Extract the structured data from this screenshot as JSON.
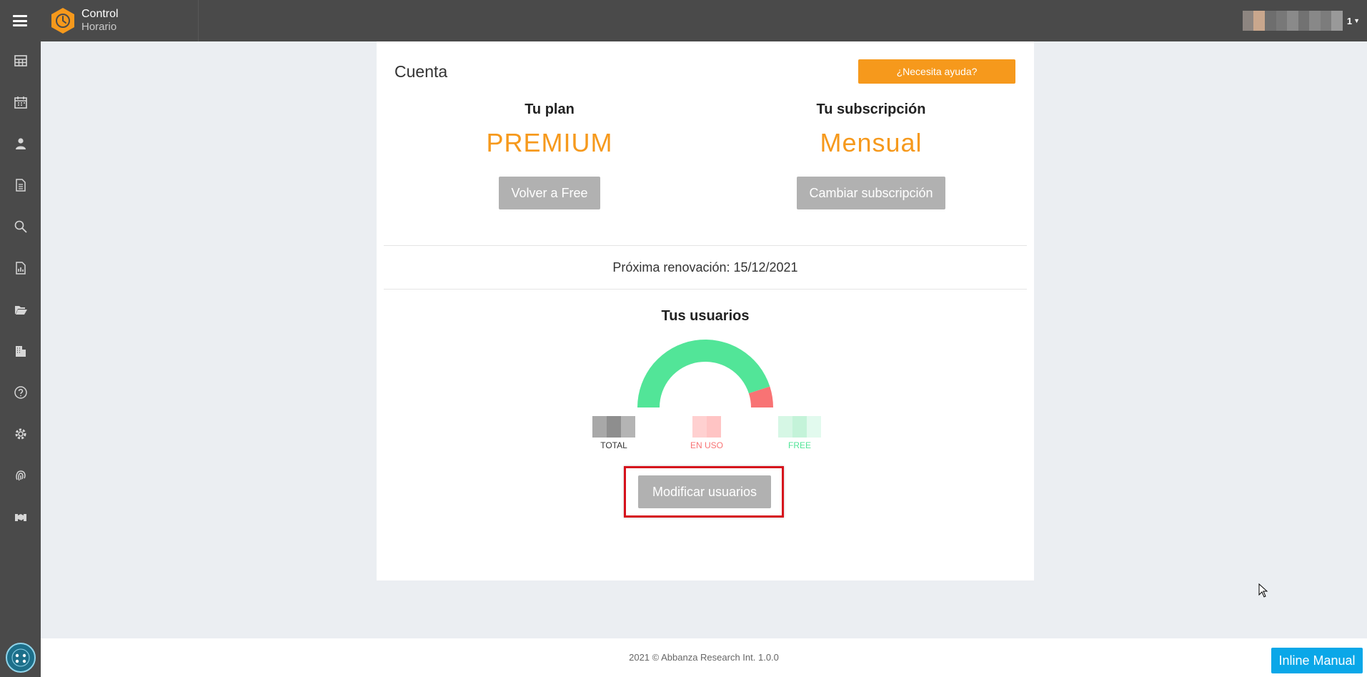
{
  "app": {
    "name_line1": "Control",
    "name_line2": "Horario",
    "brand_color": "#f6991c",
    "user_badge": "1"
  },
  "sidebar": {
    "items": [
      {
        "icon": "dashboard-icon"
      },
      {
        "icon": "calendar-icon"
      },
      {
        "icon": "user-icon"
      },
      {
        "icon": "document-icon"
      },
      {
        "icon": "search-icon"
      },
      {
        "icon": "report-icon"
      },
      {
        "icon": "folder-open-icon"
      },
      {
        "icon": "building-icon"
      },
      {
        "icon": "help-icon"
      },
      {
        "icon": "gear-icon"
      },
      {
        "icon": "fingerprint-icon"
      },
      {
        "icon": "handshake-icon"
      }
    ]
  },
  "account": {
    "title": "Cuenta",
    "help_button": "¿Necesita ayuda?",
    "plan_heading": "Tu plan",
    "plan_value": "PREMIUM",
    "plan_button": "Volver a Free",
    "subscription_heading": "Tu subscripción",
    "subscription_value": "Mensual",
    "subscription_button": "Cambiar subscripción",
    "renewal": "Próxima renovación: 15/12/2021"
  },
  "users": {
    "title": "Tus usuarios",
    "gauge": {
      "free_fraction": 0.9,
      "in_use_fraction": 0.1,
      "free_color": "#52e598",
      "in_use_color": "#f87374"
    },
    "legend": [
      {
        "label": "TOTAL",
        "color": "#333333"
      },
      {
        "label": "EN USO",
        "color": "#f87374"
      },
      {
        "label": "FREE",
        "color": "#52e598"
      }
    ],
    "modify_button": "Modificar usuarios"
  },
  "footer": {
    "text": "2021 © Abbanza Research Int. 1.0.0",
    "inline_manual": "Inline Manual"
  }
}
